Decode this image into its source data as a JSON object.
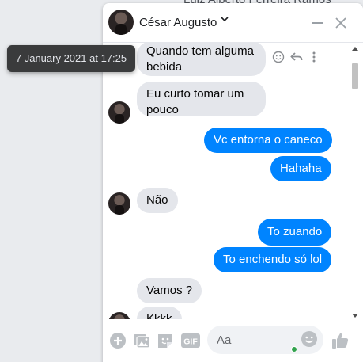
{
  "background": {
    "name": "Luiz Alberto Ferreira Ramos"
  },
  "header": {
    "name": "César Augusto"
  },
  "tooltip": {
    "timestamp": "7 January 2021 at 17:25"
  },
  "messages": [
    {
      "from": "them",
      "text": "Quando tem alguma bebida"
    },
    {
      "from": "them",
      "text": "Eu curto tomar um pouco"
    },
    {
      "from": "me",
      "text": "Vc entorna o caneco"
    },
    {
      "from": "me",
      "text": "Hahaha"
    },
    {
      "from": "them",
      "text": "Não"
    },
    {
      "from": "me",
      "text": "To zuando"
    },
    {
      "from": "me",
      "text": "To enchendo só lol"
    },
    {
      "from": "them",
      "text": "Vamos ?"
    },
    {
      "from": "them",
      "text": "Kkkk"
    }
  ],
  "composer": {
    "placeholder": "Aa",
    "gif_label": "GIF"
  },
  "colors": {
    "outgoing": "#0084ff",
    "incoming": "#e4e6eb",
    "accent": "#0084ff",
    "online": "#31a24c"
  }
}
